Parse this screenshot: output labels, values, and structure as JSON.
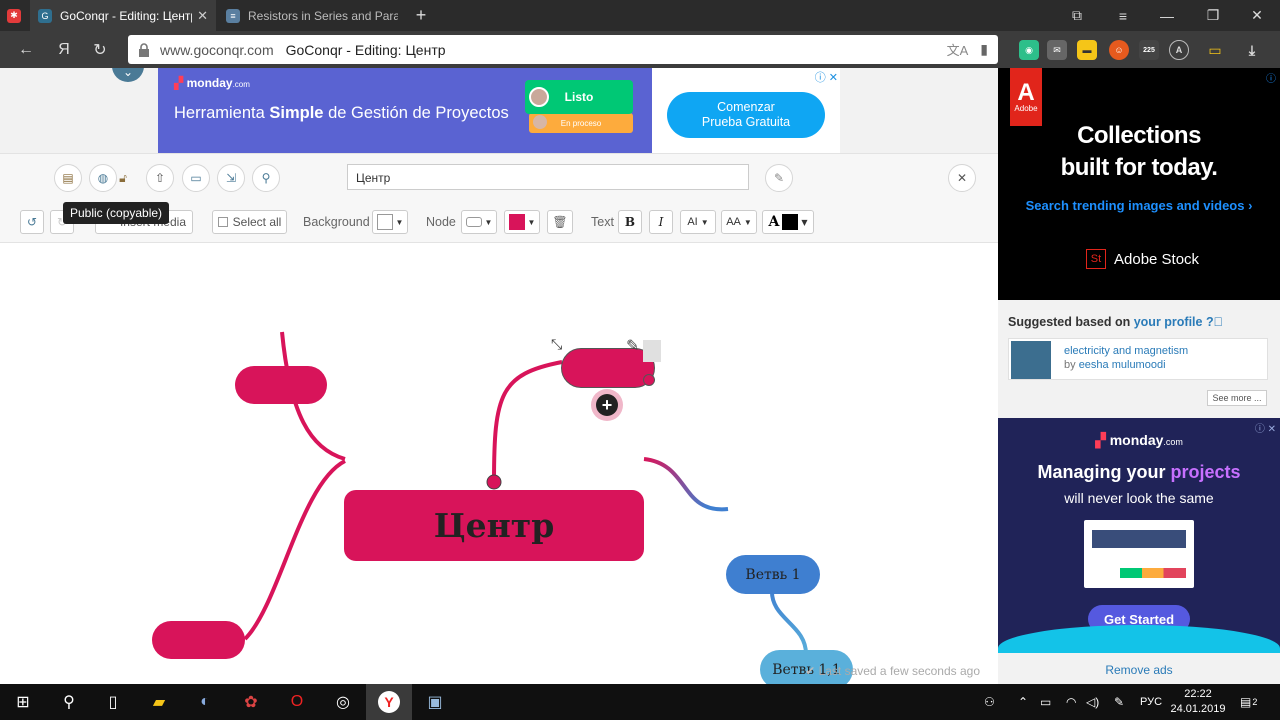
{
  "browser": {
    "tabs": [
      {
        "title": "GoConqr - Editing: Центр",
        "active": true
      },
      {
        "title": "Resistors in Series and Para",
        "active": false
      }
    ],
    "url_domain": "www.goconqr.com",
    "url_title": "GoConqr - Editing: Центр",
    "yandex_letter": "Я",
    "ext_badge": "225"
  },
  "ad_top": {
    "brand": "monday",
    "brand_suffix": ".com",
    "headline_pre": "Herramienta ",
    "headline_bold": "Simple",
    "headline_post": " de Gestión de Proyectos",
    "status_done": "Listo",
    "status_progress": "En proceso",
    "cta_line1": "Comenzar",
    "cta_line2": "Prueba Gratuita"
  },
  "toolbar": {
    "title_value": "Центр",
    "tooltip": "Public (copyable)",
    "insert_media": "Insert media",
    "select_all": "Select all",
    "background_label": "Background",
    "node_label": "Node",
    "text_label": "Text",
    "bold": "B",
    "italic": "I",
    "font_size": "AI",
    "case": "AA",
    "text_color_letter": "A"
  },
  "colors": {
    "node_pink": "#d8145a",
    "node_blue": "#3f7fd0",
    "node_lightblue": "#5ab0db"
  },
  "mindmap": {
    "center": "Центр",
    "branch1": "Ветвь 1",
    "branch11": "Ветвь 1,1"
  },
  "status": {
    "saved": "Last saved a few seconds ago"
  },
  "ad_right": {
    "adobe_brand": "Adobe",
    "adobe_line1": "Collections",
    "adobe_line2": "built for today.",
    "adobe_link": "Search trending images and videos ›",
    "adobe_stock": "Adobe Stock",
    "adobe_stock_icon": "St",
    "suggest_pre": "Suggested based on ",
    "suggest_link": "your profile",
    "sug_title": "electricity and magnetism",
    "sug_by": "by ",
    "sug_author": "eesha mulumoodi",
    "see_more": "See more ...",
    "monday_brand": "monday",
    "monday_suffix": ".com",
    "monday_h1_pre": "Managing your ",
    "monday_h1_em": "projects",
    "monday_h2": "will never look the same",
    "monday_cta": "Get Started",
    "remove_ads": "Remove ads"
  },
  "taskbar": {
    "lang": "РУС",
    "time": "22:22",
    "date": "24.01.2019",
    "notif": "2"
  }
}
